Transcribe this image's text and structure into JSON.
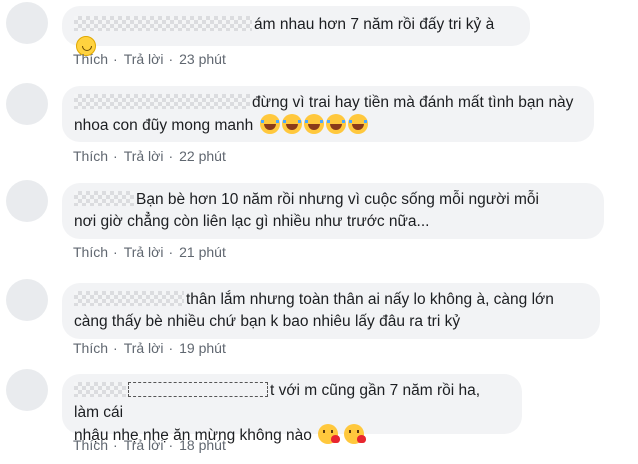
{
  "actions": {
    "like_label": "Thích",
    "reply_label": "Trả lời",
    "separator": "·"
  },
  "comments": [
    {
      "author": "",
      "text_line1": "ám nhau hơn 7 năm rồi đấy tri kỷ à",
      "text_line2": "",
      "emojis": [
        "smiling-face"
      ],
      "time": "23 phút"
    },
    {
      "author": "",
      "text_line1": "đừng vì trai hay tiền mà đánh mất tình bạn này",
      "text_line2": "nhoa con đũy mong manh",
      "emojis": [
        "face-with-tears-of-joy",
        "face-with-tears-of-joy",
        "face-with-tears-of-joy",
        "face-with-tears-of-joy",
        "face-with-tears-of-joy"
      ],
      "time": "22 phút"
    },
    {
      "author": "",
      "text_line1": "Bạn bè hơn 10 năm rồi nhưng vì cuộc sống mỗi người mỗi",
      "text_line2": "nơi giờ chẳng còn liên lạc gì nhiều như trước nữa...",
      "emojis": [],
      "time": "21 phút"
    },
    {
      "author": "",
      "text_line1": "thân lắm nhưng toàn thân ai nấy lo không à, càng lớn",
      "text_line2": "càng thấy bè nhiều chứ bạn k bao nhiêu lấy đâu ra tri kỷ",
      "emojis": [],
      "time": "19 phút"
    },
    {
      "author": "",
      "text_line1": "t với m cũng gần 7 năm rồi ha, làm cái",
      "text_line2": "nhậu nhẹ nhẹ ăn mừng không nào",
      "emojis": [
        "face-blowing-a-kiss",
        "face-blowing-a-kiss"
      ],
      "time": "18 phút"
    }
  ]
}
